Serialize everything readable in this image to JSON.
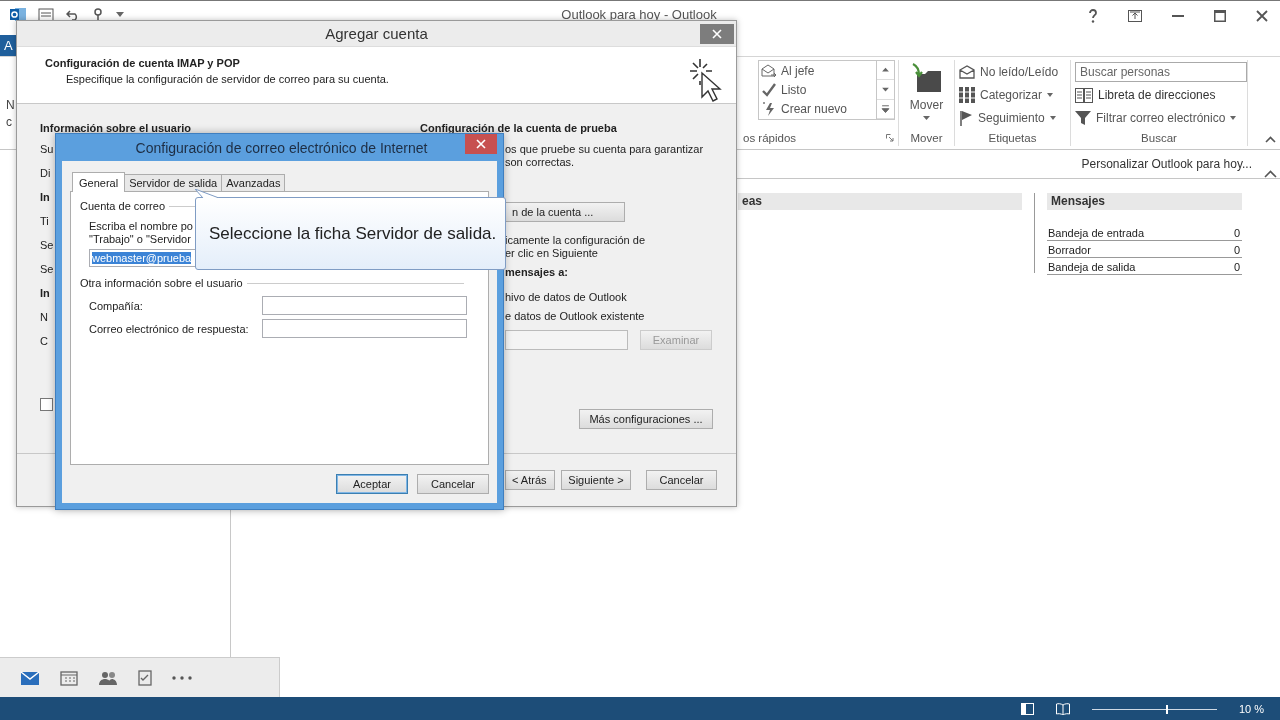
{
  "outlook": {
    "title": "Outlook para hoy - Outlook",
    "file_tab": "A",
    "new_button_lines": [
      "N",
      "c"
    ],
    "ribbon": {
      "quick_steps": {
        "items": [
          {
            "label": "Al jefe"
          },
          {
            "label": "Listo"
          },
          {
            "label": "Crear nuevo"
          }
        ],
        "group": "os rápidos"
      },
      "move": {
        "label": "Mover",
        "group": "Mover"
      },
      "tags": {
        "items": [
          {
            "label": "No leído/Leído",
            "dropdown": false
          },
          {
            "label": "Categorizar",
            "dropdown": true
          },
          {
            "label": "Seguimiento",
            "dropdown": true
          }
        ],
        "group": "Etiquetas"
      },
      "find": {
        "search_placeholder": "Buscar personas",
        "items": [
          {
            "label": "Libreta de direcciones",
            "dropdown": false
          },
          {
            "label": "Filtrar correo electrónico",
            "dropdown": true
          }
        ],
        "group": "Buscar"
      }
    },
    "customize_link": "Personalizar Outlook para hoy...",
    "tasks_header": "eas",
    "messages": {
      "title": "Mensajes",
      "rows": [
        {
          "name": "Bandeja de entrada",
          "count": "0"
        },
        {
          "name": "Borrador",
          "count": "0"
        },
        {
          "name": "Bandeja de salida",
          "count": "0"
        }
      ]
    },
    "status_bar": {
      "zoom_slider": {
        "level": 0.6
      },
      "zoom": "10 %"
    }
  },
  "account_dialog": {
    "title": "Agregar cuenta",
    "heading": "Configuración de cuenta IMAP y POP",
    "subheading": "Especifique la configuración de servidor de correo para su cuenta.",
    "left_heading": "Información sobre el usuario",
    "left_fragments": [
      {
        "text": "Su",
        "kind": "label"
      },
      {
        "text": "Di",
        "kind": "label"
      },
      {
        "text": "In",
        "kind": "heading"
      },
      {
        "text": "Ti",
        "kind": "label"
      },
      {
        "text": "Se",
        "kind": "label"
      },
      {
        "text": "Se",
        "kind": "label"
      },
      {
        "text": "In",
        "kind": "heading"
      },
      {
        "text": "N",
        "kind": "label"
      },
      {
        "text": "C",
        "kind": "label"
      }
    ],
    "checkbox_checked": false,
    "right_heading": "Configuración de la cuenta de prueba",
    "right_lines": [
      "os que pruebe su cuenta para garantizar",
      "son correctas."
    ],
    "test_button": "n de la cuenta ...",
    "auto_test_lines": [
      "icamente la configuración de",
      "er clic en Siguiente"
    ],
    "deliver_label": "mensajes a:",
    "options": [
      {
        "label": "hivo de datos de Outlook"
      },
      {
        "label": "e datos de Outlook existente"
      }
    ],
    "browse_button": {
      "label": "Examinar",
      "disabled": true
    },
    "more_settings_button": "Más configuraciones ...",
    "buttons": [
      "< Atrás",
      "Siguiente >",
      "Cancelar"
    ]
  },
  "internet_dialog": {
    "title": "Configuración de correo electrónico de Internet",
    "tabs": [
      {
        "label": "General",
        "selected": true
      },
      {
        "label": "Servidor de salida",
        "selected": false
      },
      {
        "label": "Avanzadas",
        "selected": false
      }
    ],
    "account_group": "Cuenta de correo",
    "account_hint_lines": [
      "Escriba el nombre po",
      "\"Trabajo\" o \"Servidor"
    ],
    "account_value": "webmaster@prueba",
    "other_group": "Otra información sobre el usuario",
    "fields": [
      {
        "label": "Compañía:"
      },
      {
        "label": "Correo electrónico de respuesta:"
      }
    ],
    "buttons": [
      {
        "label": "Aceptar",
        "default": true
      },
      {
        "label": "Cancelar",
        "default": false
      }
    ]
  },
  "callout": {
    "text": "Seleccione la ficha Servidor de salida."
  }
}
